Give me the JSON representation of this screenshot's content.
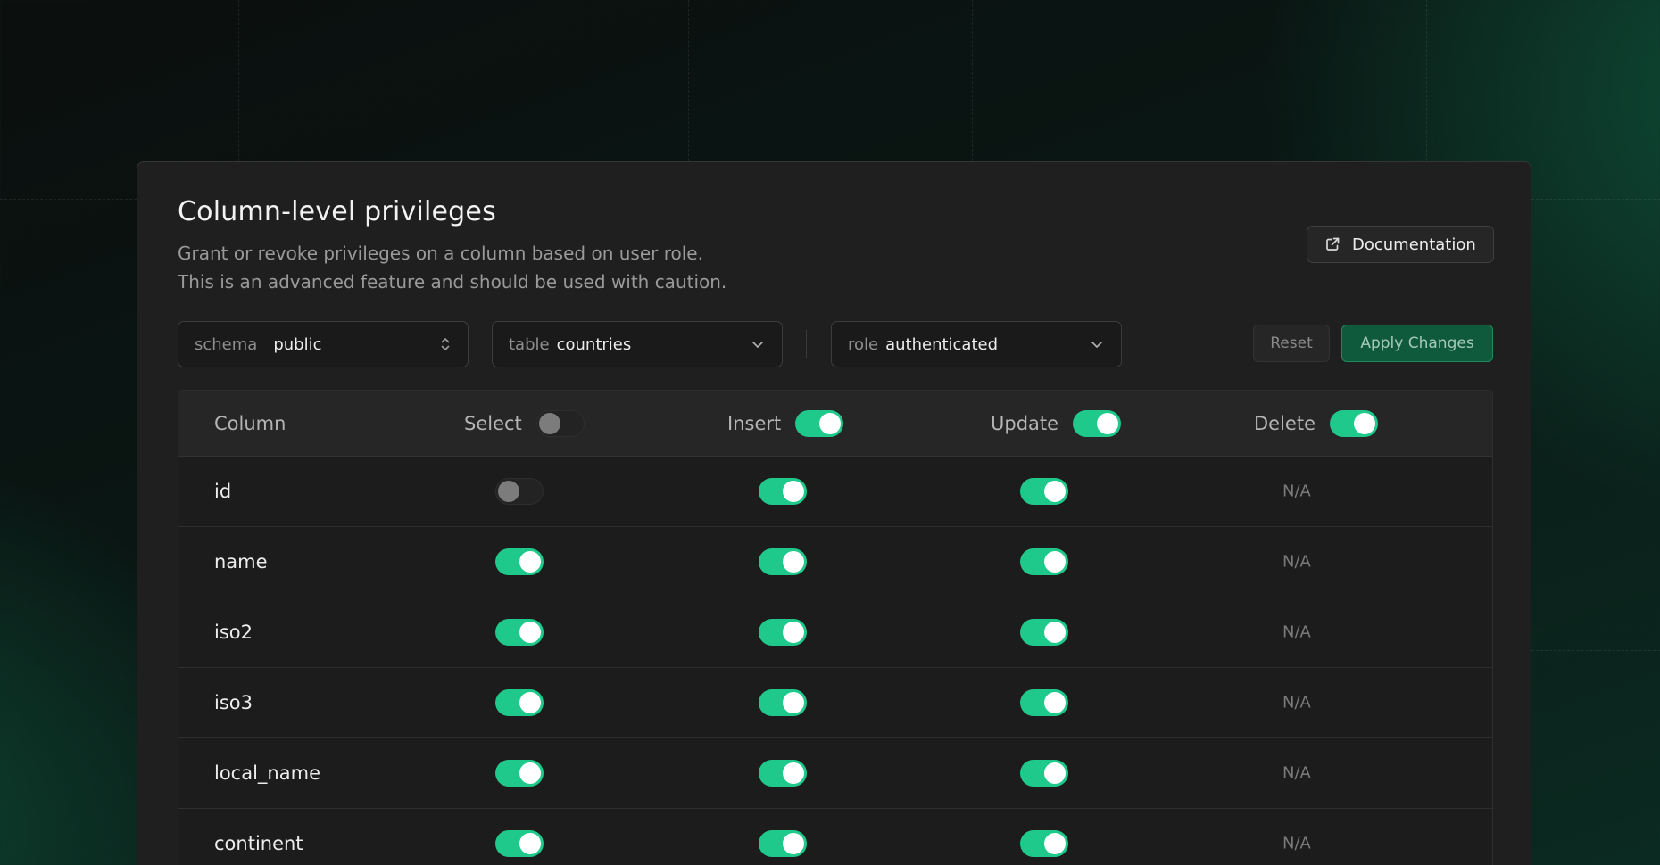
{
  "colors": {
    "accent": "#1ec98b",
    "panel_bg": "#1f1f1f",
    "apply_bg": "#0f5a3d"
  },
  "panel": {
    "title": "Column-level privileges",
    "description_line1": "Grant or revoke privileges on a column based on user role.",
    "description_line2": "This is an advanced feature and should be used with caution.",
    "documentation_button": {
      "label": "Documentation",
      "icon": "external-link-icon"
    }
  },
  "filters": {
    "schema": {
      "label": "schema",
      "value": "public",
      "icon": "chevron-up-down-icon"
    },
    "table": {
      "label": "table",
      "value": "countries",
      "icon": "chevron-down-icon"
    },
    "role": {
      "label": "role",
      "value": "authenticated",
      "icon": "chevron-down-icon"
    }
  },
  "actions": {
    "reset_label": "Reset",
    "apply_label": "Apply Changes"
  },
  "grid": {
    "headers": {
      "column": "Column",
      "select": "Select",
      "insert": "Insert",
      "update": "Update",
      "delete": "Delete"
    },
    "header_toggles": {
      "select": false,
      "insert": true,
      "update": true,
      "delete": true
    },
    "rows": [
      {
        "name": "id",
        "select": false,
        "insert": true,
        "update": true,
        "delete": "N/A"
      },
      {
        "name": "name",
        "select": true,
        "insert": true,
        "update": true,
        "delete": "N/A"
      },
      {
        "name": "iso2",
        "select": true,
        "insert": true,
        "update": true,
        "delete": "N/A"
      },
      {
        "name": "iso3",
        "select": true,
        "insert": true,
        "update": true,
        "delete": "N/A"
      },
      {
        "name": "local_name",
        "select": true,
        "insert": true,
        "update": true,
        "delete": "N/A"
      },
      {
        "name": "continent",
        "select": true,
        "insert": true,
        "update": true,
        "delete": "N/A"
      }
    ]
  }
}
